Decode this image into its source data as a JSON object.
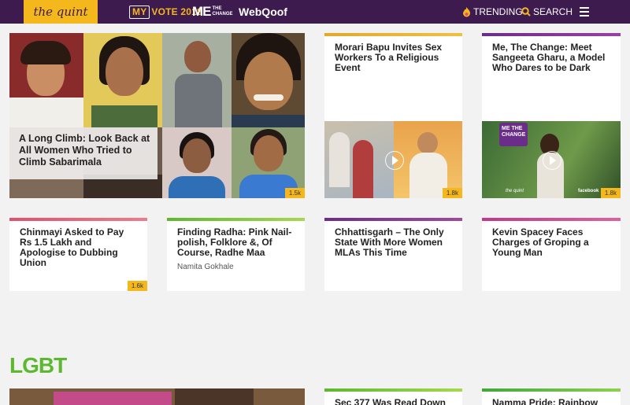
{
  "nav": {
    "logo": "the quint",
    "vote": {
      "box": "MY",
      "text": "VOTE 2018"
    },
    "me": {
      "big": "ME",
      "small_1": "THE",
      "small_2": "CHANGE"
    },
    "webqoof": "WebQoof",
    "trending": "TRENDING",
    "search": "SEARCH"
  },
  "hero": {
    "title": "A Long Climb: Look Back at All Women Who Tried to Climb Sabarimala",
    "count": "1.5k"
  },
  "cards": [
    {
      "title": "Morari Bapu Invites Sex Workers To a Religious Event",
      "count": "1.8k",
      "bar": "#e5a728"
    },
    {
      "title": "Me, The Change: Meet Sangeeta Gharu, a Model Who Dares to be Dark",
      "count": "1.8k",
      "bar": "#6b2d8a",
      "thumb_badge": "ME THE CHANGE",
      "thumb_brand_left": "the quint",
      "thumb_brand_right": "facebook"
    },
    {
      "title": "Chinmayi Asked to Pay Rs 1.5 Lakh and Apologise to Dubbing Union",
      "count": "1.6k",
      "bar": "#e0506e"
    },
    {
      "title": "Finding Radha: Pink Nail-polish, Folklore &, Of Course, Radhe Maa",
      "author": "Namita Gokhale",
      "bar": "#7cc33e"
    },
    {
      "title": "Chhattisgarh – The Only State With More Women MLAs This Time",
      "bar": "#6b2d8a"
    },
    {
      "title": "Kevin Spacey Faces Charges of Groping a Young Man",
      "bar": "#c2378a"
    }
  ],
  "section": {
    "title": "LGBT"
  },
  "lgbt_cards": [
    {
      "title": "Sec 377 Was Read Down in",
      "bar": "#7cc33e"
    },
    {
      "title": "Namma Pride: Rainbow",
      "bar": "#5cb82e"
    }
  ]
}
